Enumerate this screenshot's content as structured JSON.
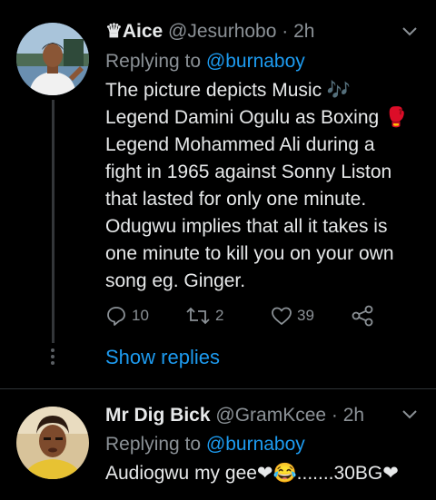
{
  "tweets": [
    {
      "display_name": "Aice",
      "crown_glyph": "♛",
      "handle": "@Jesurhobo",
      "separator": "·",
      "time": "2h",
      "replying_prefix": "Replying to",
      "replying_to": "@burnaboy",
      "body_lines": [
        "The picture depicts Music 🎶",
        "Legend Damini Ogulu as Boxing 🥊",
        "Legend Mohammed Ali during a",
        "fight in 1965 against Sonny Liston",
        "that lasted for only one minute.",
        "Odugwu implies that all it takes is",
        "one minute to kill you on your own",
        "song eg. Ginger."
      ],
      "reply_count": "10",
      "retweet_count": "2",
      "like_count": "39",
      "show_replies": "Show replies"
    },
    {
      "display_name": "Mr Dig Bick",
      "handle": "@GramKcee",
      "separator": "·",
      "time": "2h",
      "replying_prefix": "Replying to",
      "replying_to": "@burnaboy",
      "body_line": "Audiogwu my gee❤😂.......30BG❤"
    }
  ],
  "colors": {
    "background": "#000000",
    "text": "#e7e9ea",
    "secondary": "#8b9196",
    "link": "#1d9bf0",
    "divider": "#2f3336"
  },
  "icons": [
    "reply-icon",
    "retweet-icon",
    "like-icon",
    "share-icon",
    "chevron-down-icon"
  ]
}
